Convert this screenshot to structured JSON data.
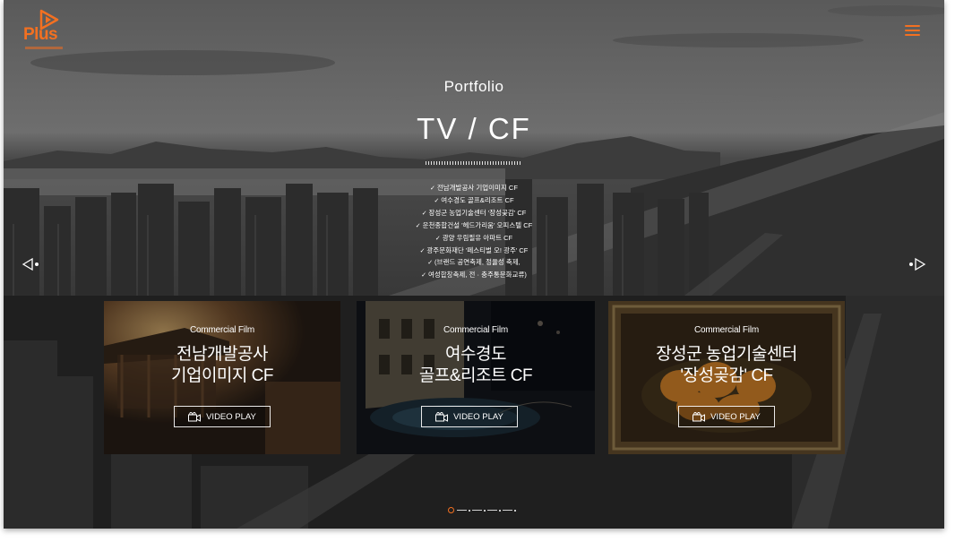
{
  "brand": {
    "logo_text": "Plus",
    "accent_color": "#f37021"
  },
  "header": {
    "menu_icon": "hamburger-menu-icon"
  },
  "hero": {
    "subtitle": "Portfolio",
    "title": "TV / CF",
    "works": [
      "전남개발공사 기업이미지 CF",
      "여수경도 골프&리조트 CF",
      "장성군 농업기술센터 '장성곶감' CF",
      "운천종합건설 '헤드가리움' 오피스텔 CF",
      "광양 우림필유 아파트 CF",
      "광주문화재단 '페스티벌 오! 광주' CF",
      "(브랜드 공연축제, 정율성 축제,",
      "여성합창축제, 전 · 충주통문화교류)"
    ]
  },
  "navigation": {
    "prev_icon": "triangle-left-icon",
    "next_icon": "triangle-right-icon"
  },
  "cards": [
    {
      "label": "Commercial Film",
      "title_line1": "전남개발공사",
      "title_line2": "기업이미지 CF",
      "button": "VIDEO PLAY"
    },
    {
      "label": "Commercial Film",
      "title_line1": "여수경도",
      "title_line2": "골프&리조트 CF",
      "button": "VIDEO PLAY"
    },
    {
      "label": "Commercial Film",
      "title_line1": "장성군 농업기술센터",
      "title_line2": "'장성곶감' CF",
      "button": "VIDEO PLAY"
    }
  ],
  "pager": {
    "active_index": 0,
    "total": 5
  }
}
